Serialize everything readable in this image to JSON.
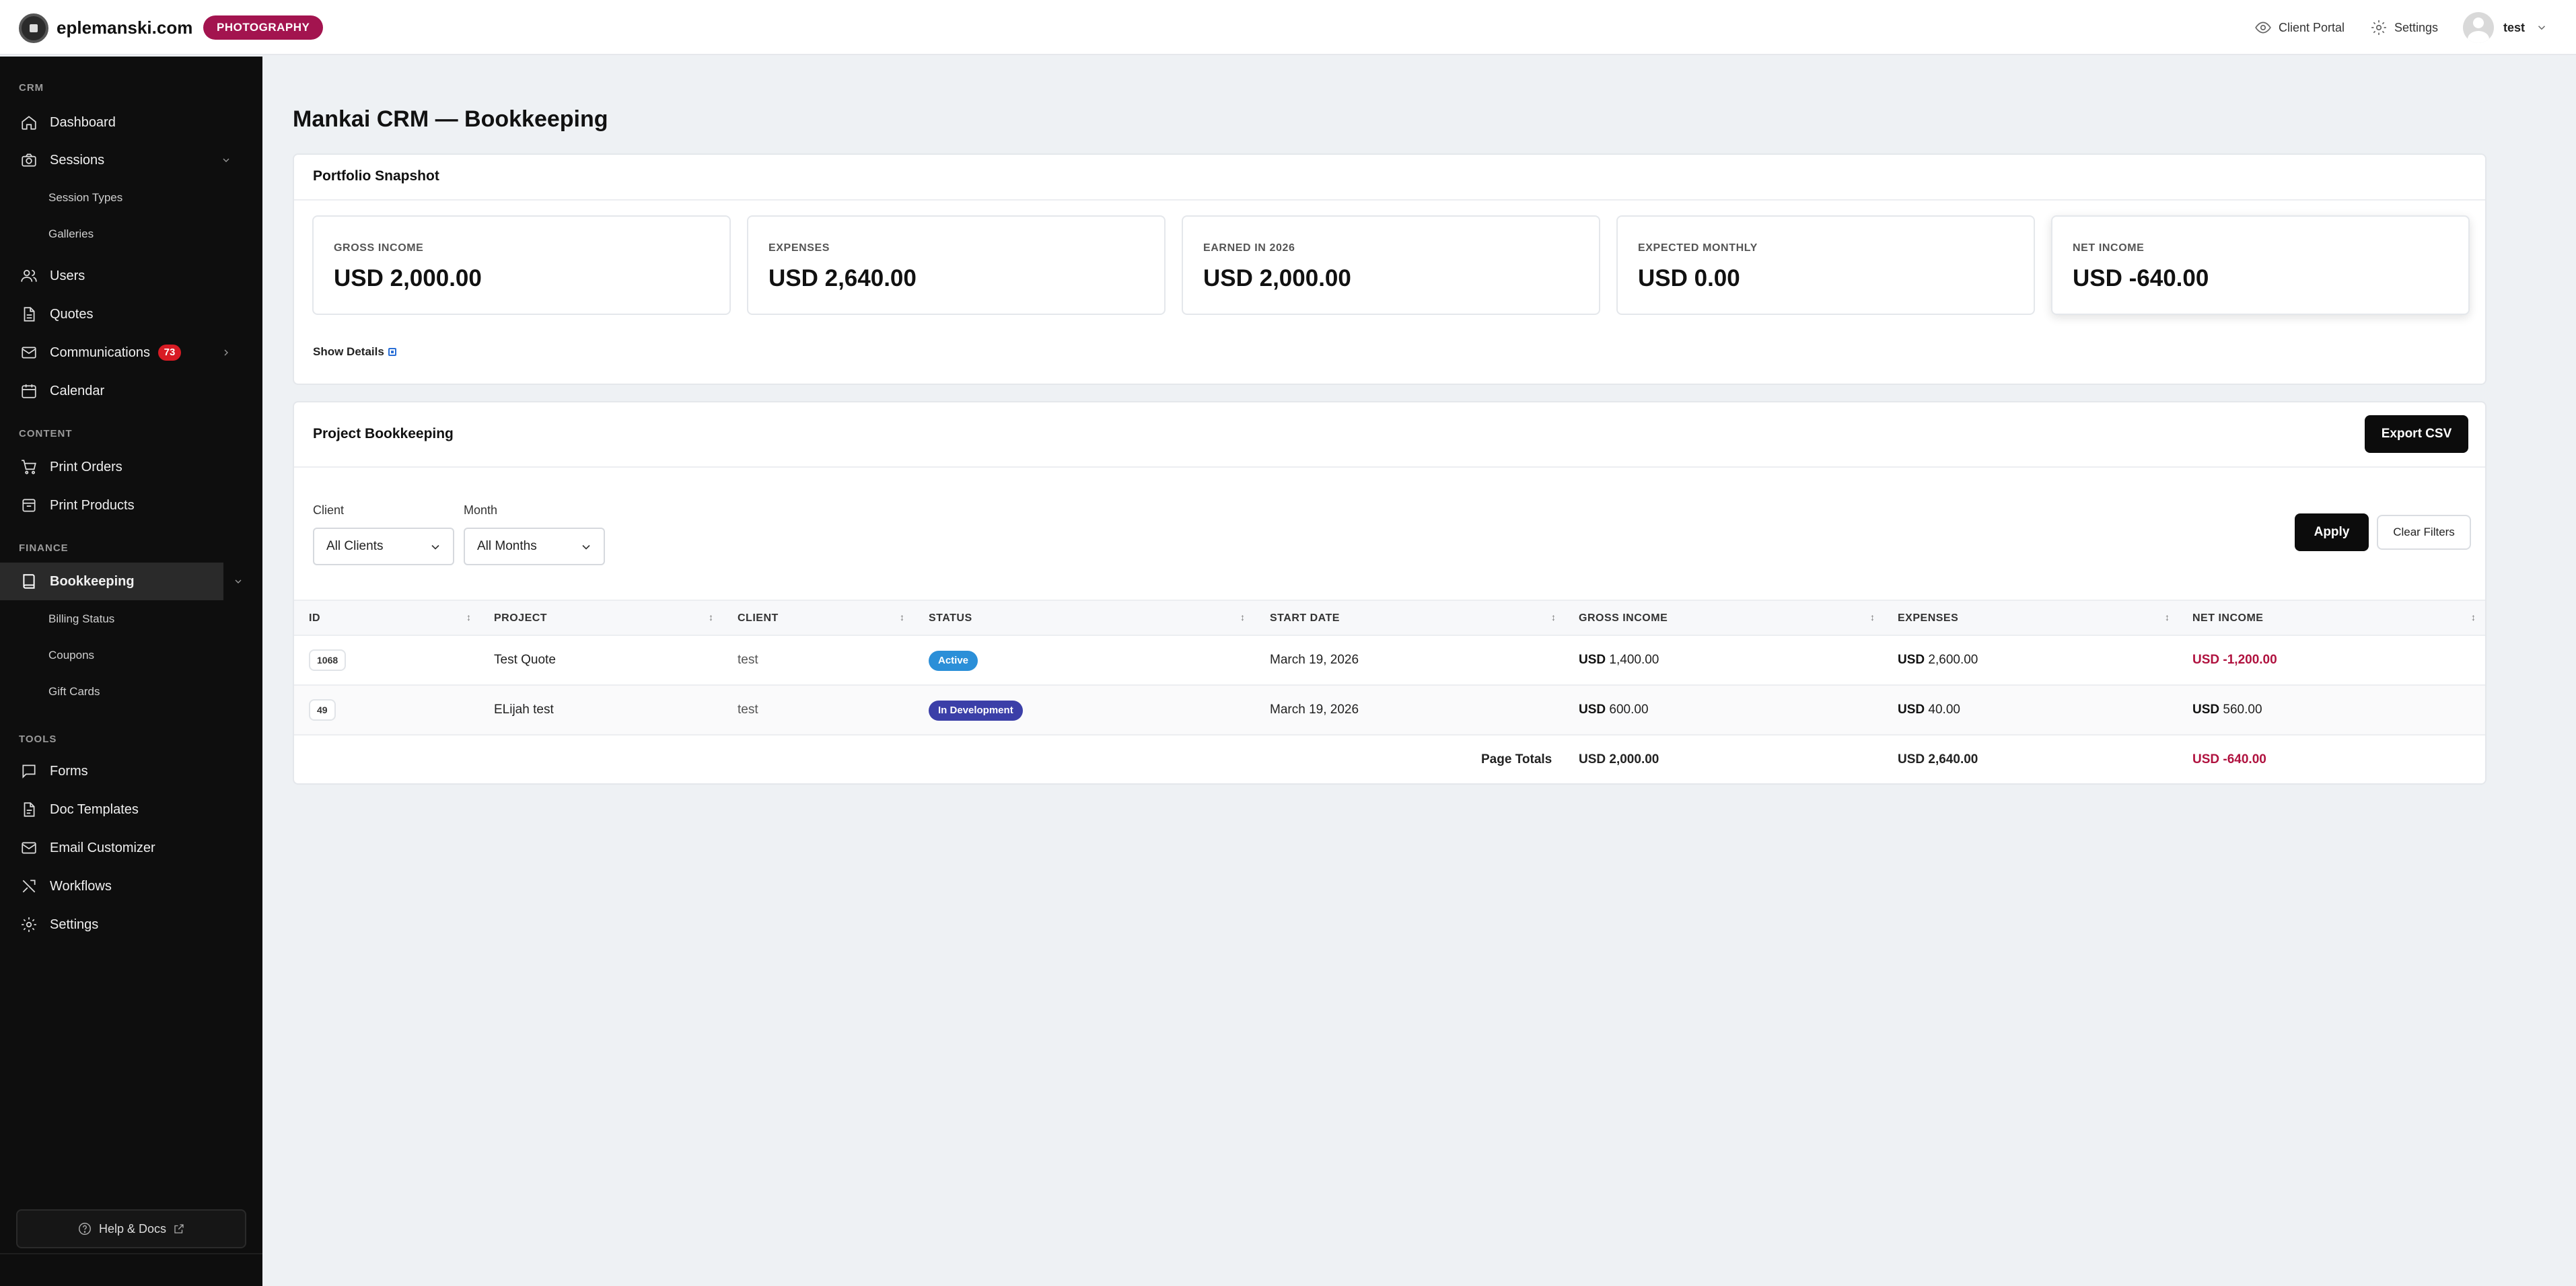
{
  "header": {
    "brand_name": "eplemanski.com",
    "brand_badge": "PHOTOGRAPHY",
    "client_portal": "Client Portal",
    "settings": "Settings",
    "user_name": "test"
  },
  "sidebar": {
    "sections": {
      "crm": "CRM",
      "content": "CONTENT",
      "finance": "FINANCE",
      "tools": "TOOLS"
    },
    "items": {
      "dashboard": "Dashboard",
      "sessions": "Sessions",
      "session_types": "Session Types",
      "galleries": "Galleries",
      "users": "Users",
      "quotes": "Quotes",
      "communications": "Communications",
      "communications_count": "73",
      "calendar": "Calendar",
      "print_orders": "Print Orders",
      "print_products": "Print Products",
      "bookkeeping": "Bookkeeping",
      "billing_status": "Billing Status",
      "coupons": "Coupons",
      "gift_cards": "Gift Cards",
      "forms": "Forms",
      "doc_templates": "Doc Templates",
      "email_customizer": "Email Customizer",
      "workflows": "Workflows",
      "settings": "Settings"
    },
    "help": "Help & Docs"
  },
  "page": {
    "title": "Mankai CRM — Bookkeeping"
  },
  "snapshot": {
    "title": "Portfolio Snapshot",
    "stats": [
      {
        "label": "GROSS INCOME",
        "value": "USD 2,000.00"
      },
      {
        "label": "EXPENSES",
        "value": "USD 2,640.00"
      },
      {
        "label": "EARNED IN 2026",
        "value": "USD 2,000.00"
      },
      {
        "label": "EXPECTED MONTHLY",
        "value": "USD 0.00"
      },
      {
        "label": "NET INCOME",
        "value": "USD -640.00"
      }
    ],
    "show_details": "Show Details"
  },
  "bookkeeping": {
    "title": "Project Bookkeeping",
    "export_label": "Export CSV",
    "filters": {
      "client_label": "Client",
      "client_value": "All Clients",
      "month_label": "Month",
      "month_value": "All Months",
      "apply": "Apply",
      "clear": "Clear Filters"
    },
    "columns": [
      "ID",
      "PROJECT",
      "CLIENT",
      "STATUS",
      "START DATE",
      "GROSS INCOME",
      "EXPENSES",
      "NET INCOME"
    ],
    "rows": [
      {
        "id": "1068",
        "project": "Test Quote",
        "client": "test",
        "status": "Active",
        "status_color": "#2b8fd8",
        "start": "March 19, 2026",
        "gross_cur": "USD",
        "gross": "1,400.00",
        "exp_cur": "USD",
        "expenses": "2,600.00",
        "net_cur": "USD",
        "net": "-1,200.00"
      },
      {
        "id": "49",
        "project": "ELijah test",
        "client": "test",
        "status": "In Development",
        "status_color": "#3b3fa8",
        "start": "March 19, 2026",
        "gross_cur": "USD",
        "gross": "600.00",
        "exp_cur": "USD",
        "expenses": "40.00",
        "net_cur": "USD",
        "net": "560.00"
      }
    ],
    "totals": {
      "label": "Page Totals",
      "gross": "USD 2,000.00",
      "expenses": "USD 2,640.00",
      "net": "USD -640.00"
    }
  }
}
